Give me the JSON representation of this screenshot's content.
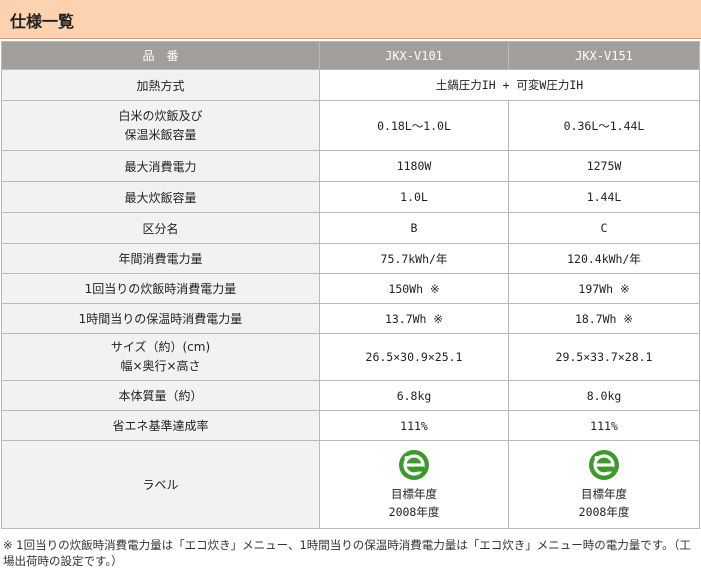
{
  "page": {
    "title": "仕様一覧"
  },
  "table": {
    "header": {
      "label_col": "品　番",
      "col1": "JKX-V101",
      "col2": "JKX-V151"
    },
    "rows": [
      {
        "label": "加熱方式",
        "merged": "土鍋圧力IH + 可変W圧力IH"
      },
      {
        "label_line1": "白米の炊飯及び",
        "label_line2": "保温米飯容量",
        "v1": "0.18L～1.0L",
        "v2": "0.36L～1.44L"
      },
      {
        "label": "最大消費電力",
        "v1": "1180W",
        "v2": "1275W"
      },
      {
        "label": "最大炊飯容量",
        "v1": "1.0L",
        "v2": "1.44L"
      },
      {
        "label": "区分名",
        "v1": "B",
        "v2": "C"
      },
      {
        "label": "年間消費電力量",
        "v1": "75.7kWh/年",
        "v2": "120.4kWh/年"
      },
      {
        "label": "1回当りの炊飯時消費電力量",
        "v1": "150Wh ※",
        "v2": "197Wh ※"
      },
      {
        "label": "1時間当りの保温時消費電力量",
        "v1": "13.7Wh ※",
        "v2": "18.7Wh ※"
      },
      {
        "label_line1": "サイズ（約）(cm)",
        "label_line2": "幅×奥行×高さ",
        "v1": "26.5×30.9×25.1",
        "v2": "29.5×33.7×28.1"
      },
      {
        "label": "本体質量（約）",
        "v1": "6.8kg",
        "v2": "8.0kg"
      },
      {
        "label": "省エネ基準達成率",
        "v1": "111%",
        "v2": "111%"
      },
      {
        "label": "ラベル",
        "v1": {
          "line1": "目標年度",
          "line2": "2008年度"
        },
        "v2": {
          "line1": "目標年度",
          "line2": "2008年度"
        }
      }
    ]
  },
  "colors": {
    "header_bg": "#fcd2b0",
    "th_bg": "#a19e9c",
    "label_bg": "#f2f2f2",
    "eco_green": "#3a9a2a"
  },
  "icons": {
    "eco_label": "eco-e-icon"
  },
  "note": "※ 1回当りの炊飯時消費電力量は「エコ炊き」メニュー、1時間当りの保温時消費電力量は「エコ炊き」メニュー時の電力量です。（工場出荷時の設定です。）"
}
